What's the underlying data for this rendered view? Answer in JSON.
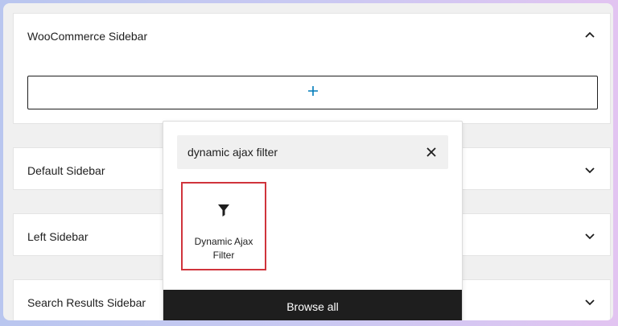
{
  "panels": {
    "woocommerce": {
      "title": "WooCommerce Sidebar",
      "expanded": true,
      "icon": "chevron-up-icon"
    },
    "default": {
      "title": "Default Sidebar",
      "expanded": false,
      "icon": "chevron-down-icon"
    },
    "left": {
      "title": "Left Sidebar",
      "expanded": false,
      "icon": "chevron-down-icon"
    },
    "search": {
      "title": "Search Results Sidebar",
      "expanded": false,
      "icon": "chevron-down-icon"
    }
  },
  "appender": {
    "icon": "plus-icon",
    "icon_color": "#007cba"
  },
  "inserter": {
    "search_value": "dynamic ajax filter",
    "clear_icon": "close-icon",
    "result": {
      "label": "Dynamic Ajax Filter",
      "icon": "filter-funnel-icon",
      "highlight_color": "#d0343c"
    },
    "browse_all_label": "Browse all"
  }
}
